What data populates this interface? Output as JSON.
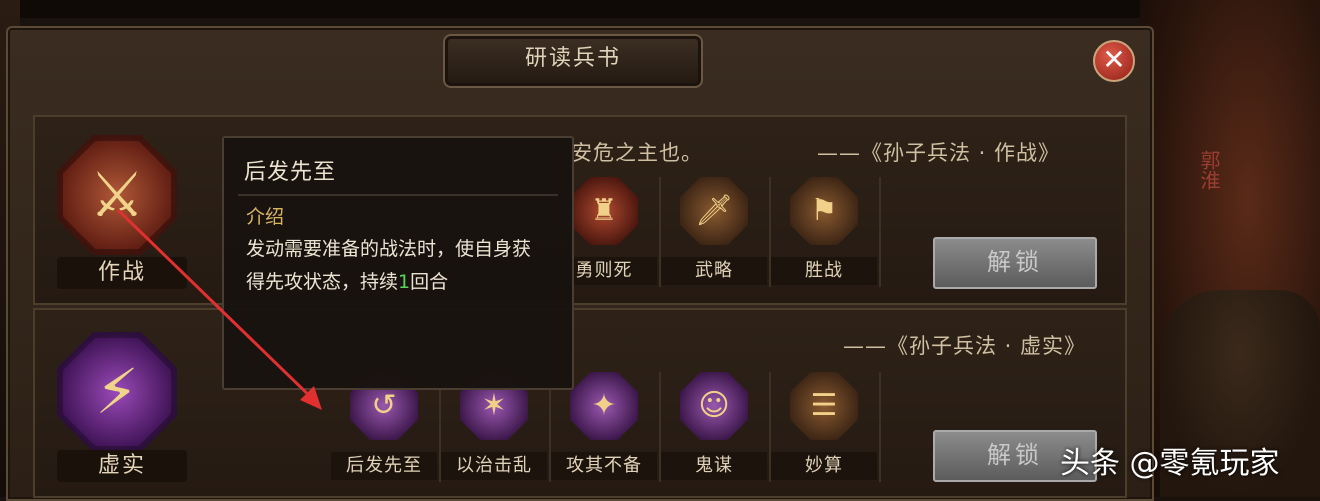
{
  "window": {
    "title": "研读兵书",
    "close_icon": "close-icon"
  },
  "background": {
    "side_banner": "郭淮"
  },
  "rows": [
    {
      "emblem_icon": "crossed-swords-icon",
      "emblem_label": "作战",
      "quote_visible": "安危之主也。",
      "source": "——《孙子兵法 · 作战》",
      "skills": [
        {
          "label": "勇则死",
          "icon": "warrior-icon"
        },
        {
          "label": "武略",
          "icon": "sword-icon"
        },
        {
          "label": "胜战",
          "icon": "banner-icon"
        }
      ],
      "unlock_label": "解锁"
    },
    {
      "emblem_icon": "broken-banner-icon",
      "emblem_label": "虚实",
      "source": "——《孙子兵法 · 虚实》",
      "skills": [
        {
          "label": "后发先至",
          "icon": "swirl-arrow-icon"
        },
        {
          "label": "以治击乱",
          "icon": "strike-icon"
        },
        {
          "label": "攻其不备",
          "icon": "ambush-icon"
        },
        {
          "label": "鬼谋",
          "icon": "strategist-icon"
        },
        {
          "label": "妙算",
          "icon": "scroll-icon"
        }
      ],
      "unlock_label": "解锁"
    }
  ],
  "tooltip": {
    "title": "后发先至",
    "heading": "介绍",
    "body_prefix": "发动需要准备的战法时，使自身获得先攻状态，持续",
    "duration_num": "1",
    "body_suffix": "回合"
  },
  "watermark": "头条 @零氪玩家",
  "colors": {
    "accent_gold": "#d9b560",
    "highlight_green": "#58d45a",
    "close_red": "#c13a2c",
    "annotation_arrow": "#e03030"
  }
}
